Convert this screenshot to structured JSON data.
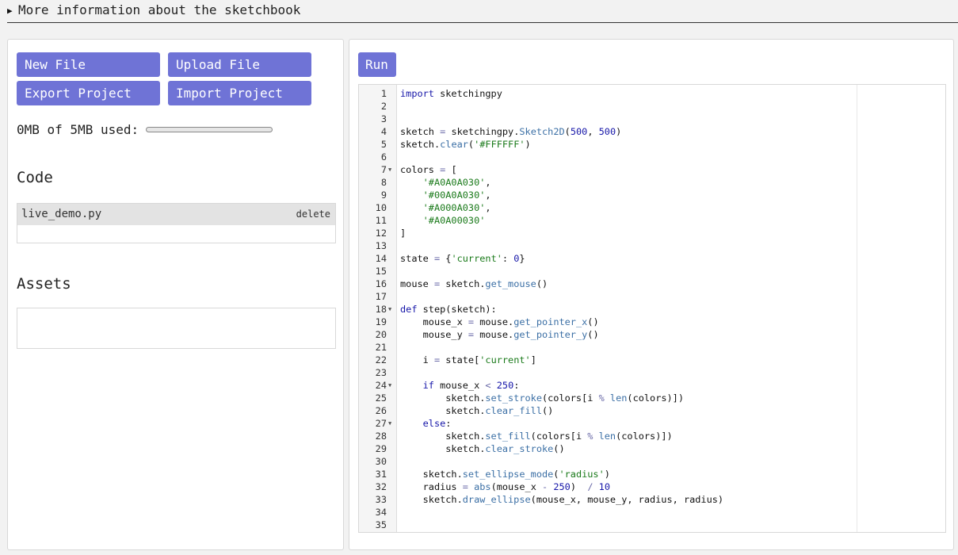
{
  "details": {
    "summary": "More information about the sketchbook"
  },
  "left": {
    "buttons": {
      "new_file": "New File",
      "upload_file": "Upload File",
      "export_project": "Export Project",
      "import_project": "Import Project"
    },
    "storage": {
      "label": "0MB of 5MB used:",
      "used_fraction": 0
    },
    "code_section": {
      "title": "Code",
      "files": [
        {
          "name": "live_demo.py",
          "delete_label": "delete"
        }
      ]
    },
    "assets_section": {
      "title": "Assets",
      "items": []
    }
  },
  "right": {
    "run_label": "Run",
    "editor": {
      "lines": [
        "import sketchingpy",
        "",
        "",
        "sketch = sketchingpy.Sketch2D(500, 500)",
        "sketch.clear('#FFFFFF')",
        "",
        "colors = [",
        "    '#A0A0A030',",
        "    '#00A0A030',",
        "    '#A000A030',",
        "    '#A0A00030'",
        "]",
        "",
        "state = {'current': 0}",
        "",
        "mouse = sketch.get_mouse()",
        "",
        "def step(sketch):",
        "    mouse_x = mouse.get_pointer_x()",
        "    mouse_y = mouse.get_pointer_y()",
        "",
        "    i = state['current']",
        "",
        "    if mouse_x < 250:",
        "        sketch.set_stroke(colors[i % len(colors)])",
        "        sketch.clear_fill()",
        "    else:",
        "        sketch.set_fill(colors[i % len(colors)])",
        "        sketch.clear_stroke()",
        "",
        "    sketch.set_ellipse_mode('radius')",
        "    radius = abs(mouse_x - 250)  / 10",
        "    sketch.draw_ellipse(mouse_x, mouse_y, radius, radius)",
        "",
        ""
      ],
      "fold_lines": [
        7,
        18,
        24,
        27
      ]
    }
  }
}
